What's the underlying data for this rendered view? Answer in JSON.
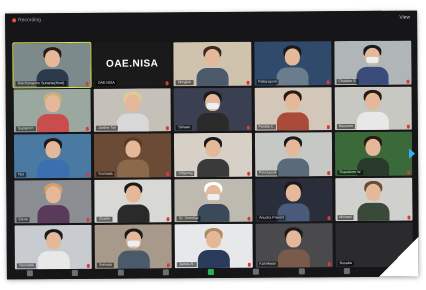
{
  "window": {
    "recording_label": "Recording",
    "view_label": "View"
  },
  "logo_tile": {
    "text": "OAE.NISA"
  },
  "participants": [
    {
      "name": "Ratchanaporn Sunanta(Host)",
      "bg": "#7d8a8c",
      "hair": "#2a1c14",
      "body": "#2c3a4e"
    },
    {
      "name": "OAE.NISA",
      "logo": true
    },
    {
      "name": "Nongluk",
      "bg": "#cfc3ad",
      "hair": "#3a2a20",
      "body": "#4a5a6a"
    },
    {
      "name": "Pattaraporn",
      "bg": "#2f4a6a",
      "hair": "#1a1a1a",
      "body": "#6b7c8c"
    },
    {
      "name": "Chatdao S.",
      "bg": "#b0b5b8",
      "hair": "#1a1a1a",
      "body": "#3a4d7a",
      "mask": true
    },
    {
      "name": "Supaporn",
      "bg": "#9aa8a0",
      "hair": "#c9b07a",
      "body": "#c94d4d"
    },
    {
      "name": "Justine Tan",
      "bg": "#c5c0b8",
      "hair": "#e3c998",
      "body": "#d8d8d8"
    },
    {
      "name": "Siriwan",
      "bg": "#3a3f52",
      "hair": "#1a1a1a",
      "body": "#2a2a2a",
      "mask": true
    },
    {
      "name": "Panida K.",
      "bg": "#d2c7b8",
      "hair": "#2a1a12",
      "body": "#aa4a3a"
    },
    {
      "name": "Warunee",
      "bg": "#c8c8c2",
      "hair": "#2a1a12",
      "body": "#e8e8e8"
    },
    {
      "name": "Nut",
      "bg": "#4a7aa2",
      "hair": "#1a1a1a",
      "body": "#3c6fb0"
    },
    {
      "name": "Suchada",
      "bg": "#6b4a36",
      "hair": "#5a3a24",
      "body": "#8a6a4a"
    },
    {
      "name": "Kittipong",
      "bg": "#d6d0c6",
      "hair": "#1a1a1a",
      "body": "#3a3a3a"
    },
    {
      "name": "Pimchanok",
      "bg": "#c5c8c5",
      "hair": "#1a1a1a",
      "body": "#5a6a7a"
    },
    {
      "name": "Thanakorn W.",
      "bg": "#3a6a3a",
      "hair": "#2a1a12",
      "body": "#2a3a2a"
    },
    {
      "name": "Elena",
      "bg": "#8a8e92",
      "hair": "#d0a070",
      "body": "#5a3a5a"
    },
    {
      "name": "Charlie",
      "bg": "#d8d8d4",
      "hair": "#1a1a1a",
      "body": "#2a2a2a"
    },
    {
      "name": "Dr. Somchai",
      "bg": "#bfbab0",
      "hair": "#ffffff",
      "body": "#3a4a5a",
      "mask": true
    },
    {
      "name": "Anucha Prasert",
      "bg": "#2a2d3a",
      "hair": "#1a1a1a",
      "body": "#4a5a7a"
    },
    {
      "name": "Michael",
      "bg": "#d0d0cc",
      "hair": "#6a4a30",
      "body": "#3a4a3a"
    },
    {
      "name": "Yaowalak",
      "bg": "#c8ccd0",
      "hair": "#1a1a1a",
      "body": "#e8e8e8"
    },
    {
      "name": "Somsak",
      "bg": "#a89a8a",
      "hair": "#1a1a1a",
      "body": "#4a5a6a",
      "mask": true
    },
    {
      "name": "James R.",
      "bg": "#e6e8ea",
      "hair": "#b08a60",
      "body": "#2a3a5a"
    },
    {
      "name": "Kanokwan",
      "bg": "#4a4a4c",
      "hair": "#1a1a1a",
      "body": "#7a5a4a"
    },
    {
      "name": "Busaba",
      "bg": "#2b2b2e",
      "empty": true
    }
  ]
}
